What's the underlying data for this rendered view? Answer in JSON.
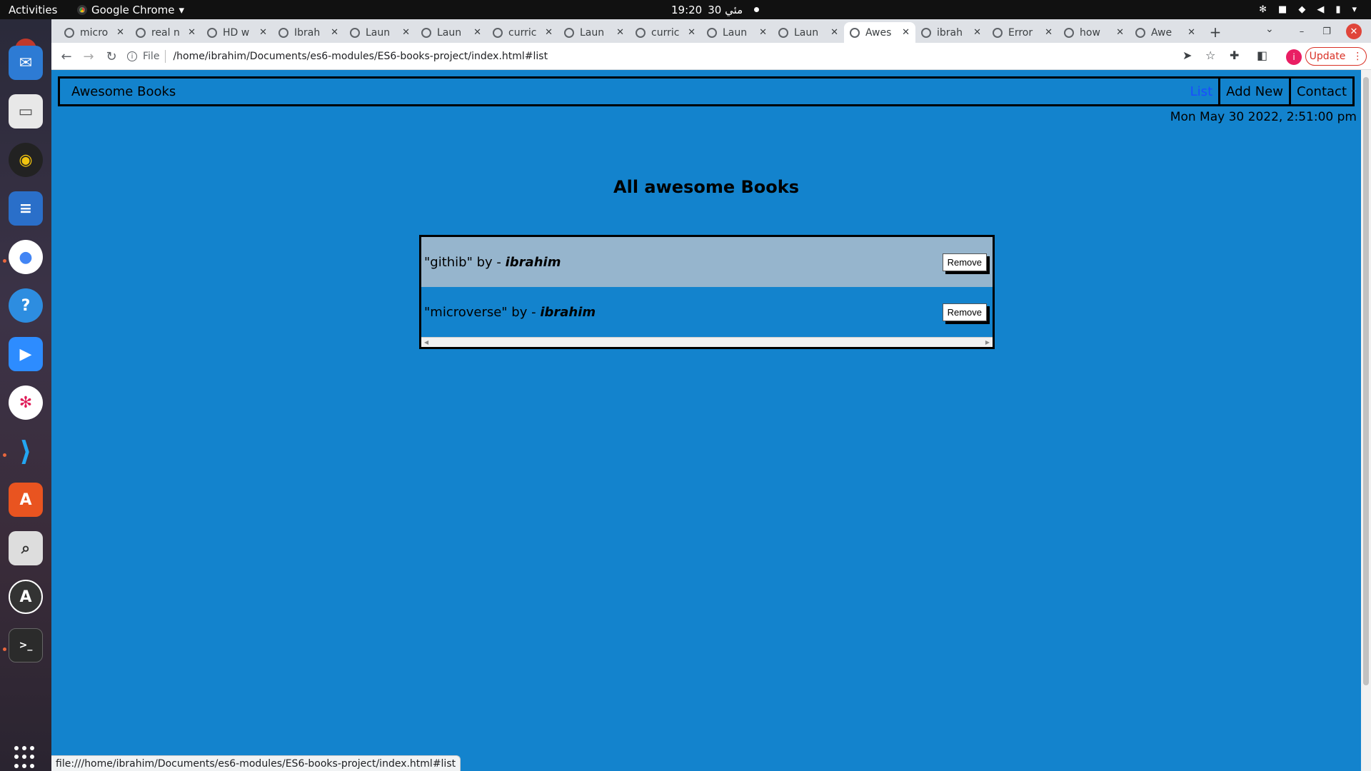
{
  "topbar": {
    "activities": "Activities",
    "app_name": "Google Chrome",
    "time": "19:20",
    "date": "30 مئي"
  },
  "tabs": [
    {
      "title": "micro"
    },
    {
      "title": "real n"
    },
    {
      "title": "HD w"
    },
    {
      "title": "Ibrah"
    },
    {
      "title": "Laun"
    },
    {
      "title": "Laun"
    },
    {
      "title": "curric"
    },
    {
      "title": "Laun"
    },
    {
      "title": "curric"
    },
    {
      "title": "Laun"
    },
    {
      "title": "Laun"
    },
    {
      "title": "Awes"
    },
    {
      "title": "ibrah"
    },
    {
      "title": "Error"
    },
    {
      "title": "how"
    },
    {
      "title": "Awe"
    }
  ],
  "toolbar": {
    "scheme": "File",
    "url": "/home/ibrahim/Documents/es6-modules/ES6-books-project/index.html#list",
    "update_label": "Update",
    "profile_initial": "i"
  },
  "page": {
    "brand": "Awesome Books",
    "nav": [
      {
        "label": "List",
        "active": true
      },
      {
        "label": "Add New",
        "active": false
      },
      {
        "label": "Contact",
        "active": false
      }
    ],
    "datetime": "Mon May 30 2022, 2:51:00 pm",
    "list_title": "All awesome Books",
    "books": [
      {
        "title": "\"githib\" by - ",
        "author": "ibrahim",
        "remove_label": "Remove"
      },
      {
        "title": "\"microverse\" by - ",
        "author": "ibrahim",
        "remove_label": "Remove"
      }
    ]
  },
  "status_url": "file:///home/ibrahim/Documents/es6-modules/ES6-books-project/index.html#list",
  "colors": {
    "page_bg": "#1383cd",
    "row_alt": "#96b5cd",
    "active_link": "#1a4dff"
  }
}
